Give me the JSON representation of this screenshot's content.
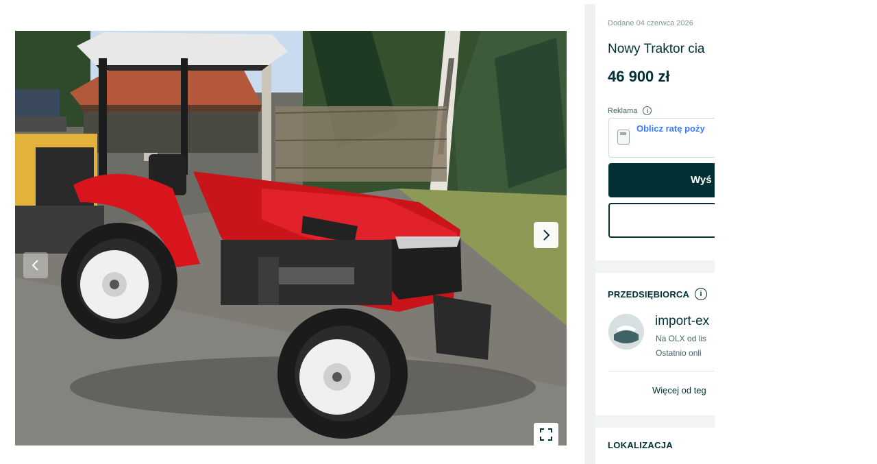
{
  "gallery": {
    "image_alt": "Czerwony traktor na placu",
    "prev_icon": "chevron-left-icon",
    "next_icon": "chevron-right-icon",
    "fullscreen_icon": "fullscreen-icon"
  },
  "listing": {
    "added": "Dodane 04 czerwca 2026",
    "title": "Nowy Traktor cia",
    "price": "46 900 zł",
    "ad_label": "Reklama",
    "loan_link": "Oblicz ratę poży",
    "primary_button": "Wyś"
  },
  "seller": {
    "label": "PRZEDSIĘBIORCA",
    "name": "import-ex",
    "since": "Na OLX od lis",
    "last_online": "Ostatnio onli",
    "more_link": "Więcej od teg"
  },
  "location": {
    "label": "LOKALIZACJA"
  },
  "colors": {
    "dark": "#002f34",
    "link": "#3a77ff",
    "muted": "#7f9799",
    "tractor_red": "#d8141c"
  }
}
